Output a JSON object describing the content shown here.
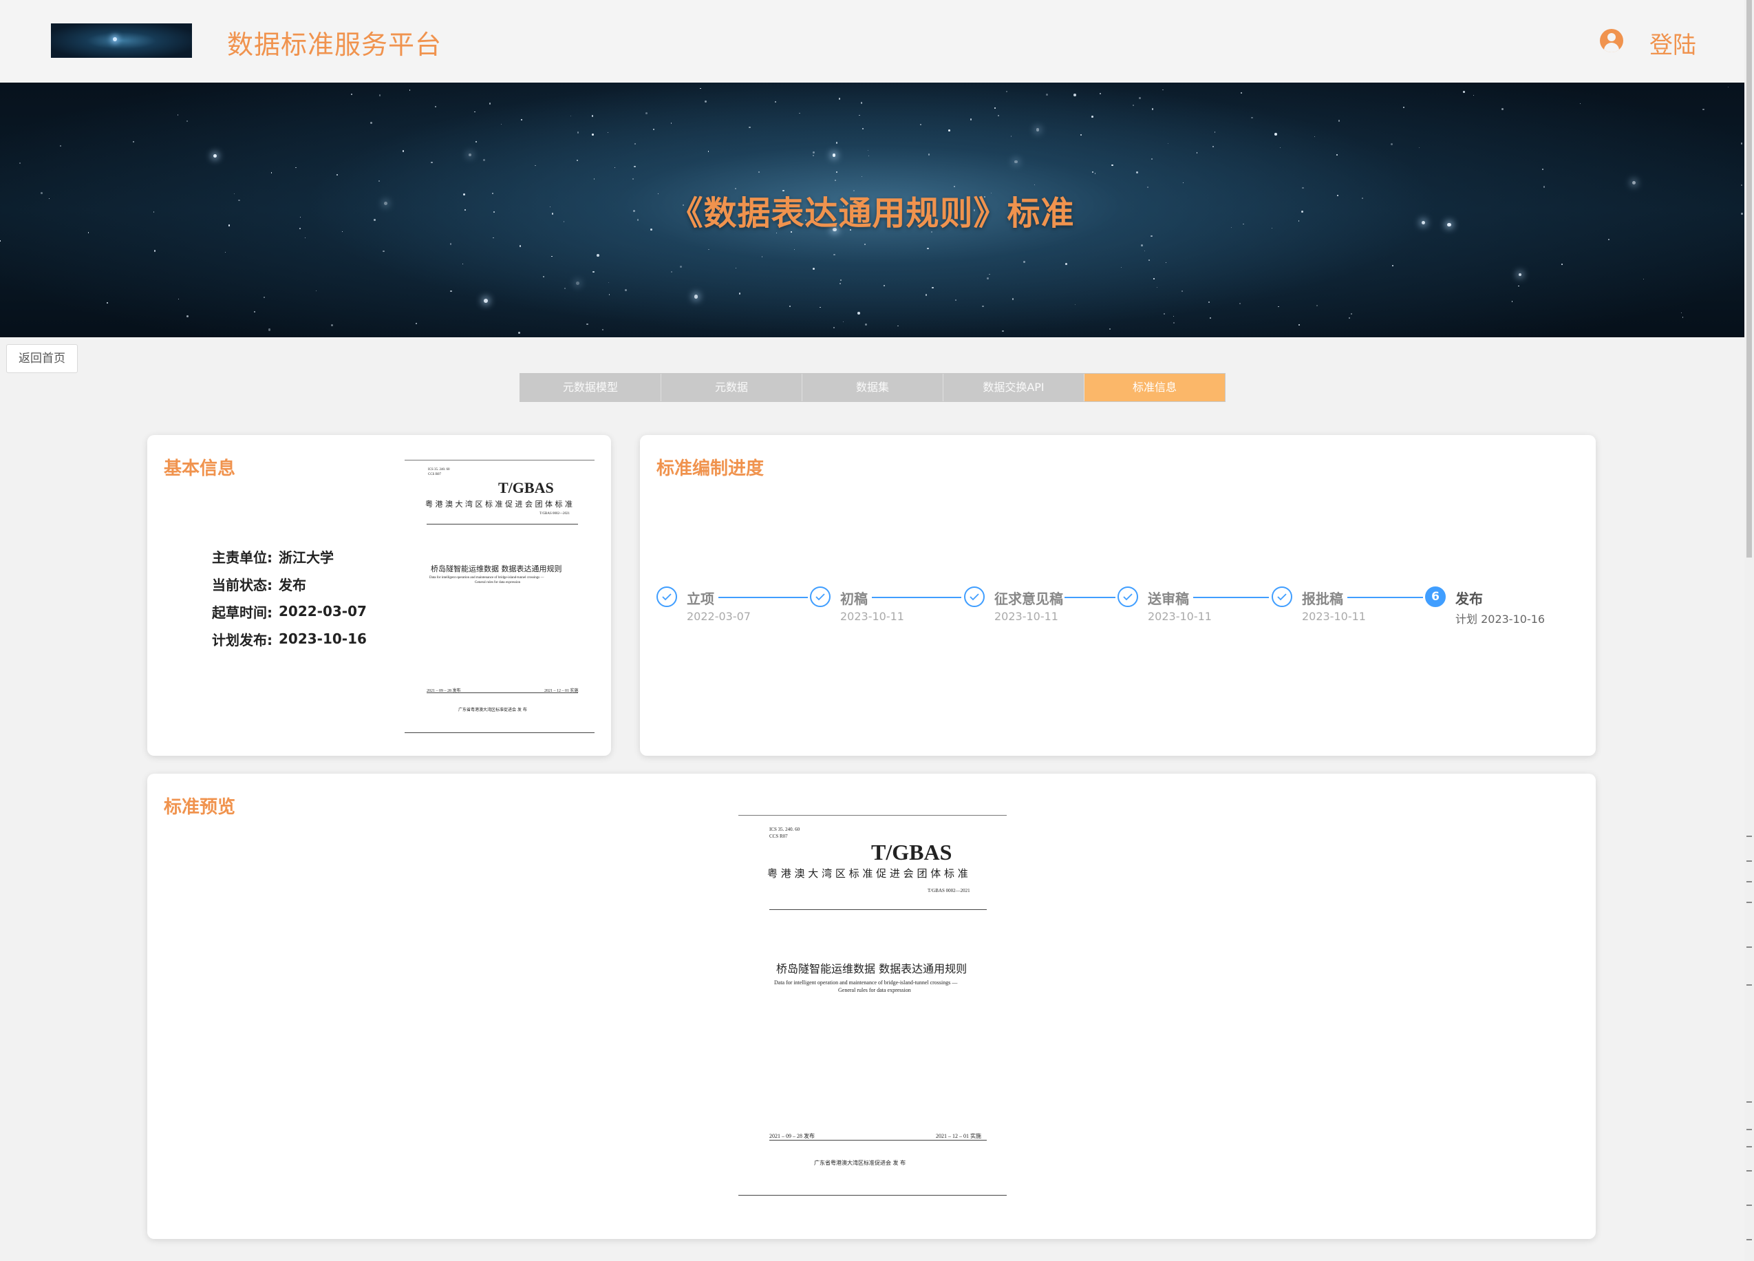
{
  "header": {
    "site_title": "数据标准服务平台",
    "login_label": "登陆",
    "user_icon": "user-circle-icon",
    "accent_color": "#f0934e"
  },
  "banner": {
    "title": "《数据表达通用规则》标准"
  },
  "nav": {
    "back_label": "返回首页",
    "tabs": [
      {
        "label": "元数据模型",
        "active": false
      },
      {
        "label": "元数据",
        "active": false
      },
      {
        "label": "数据集",
        "active": false
      },
      {
        "label": "数据交换API",
        "active": false
      },
      {
        "label": "标准信息",
        "active": true
      }
    ]
  },
  "basic_info": {
    "title": "基本信息",
    "rows": [
      {
        "key": "主责单位:",
        "value": "浙江大学"
      },
      {
        "key": "当前状态:",
        "value": "发布"
      },
      {
        "key": "起草时间:",
        "value": "2022-03-07"
      },
      {
        "key": "计划发布:",
        "value": "2023-10-16"
      }
    ]
  },
  "document": {
    "ics": "ICS  35. 240. 60",
    "ccs": "CCS  R07",
    "code": "T/GBAS",
    "org": "粤 港 澳 大 湾 区 标 准 促 进 会 团 体 标 准",
    "number": "T/GBAS  0002—2021",
    "title_cn": "桥岛隧智能运维数据  数据表达通用规则",
    "title_en_1": "Data for intelligent operation and maintenance of bridge-island-tunnel crossings —",
    "title_en_2": "General rules for data expression",
    "issue_date": "2021 – 09 – 28 发布",
    "impl_date": "2021 – 12 – 01 实施",
    "publisher": "广东省粤港澳大湾区标准促进会     发 布"
  },
  "progress": {
    "title": "标准编制进度",
    "status_color": "#409eff",
    "steps": [
      {
        "label": "立项",
        "date": "2022-03-07",
        "done": true
      },
      {
        "label": "初稿",
        "date": "2023-10-11",
        "done": true
      },
      {
        "label": "征求意见稿",
        "date": "2023-10-11",
        "done": true
      },
      {
        "label": "送审稿",
        "date": "2023-10-11",
        "done": true
      },
      {
        "label": "报批稿",
        "date": "2023-10-11",
        "done": true
      },
      {
        "label": "发布",
        "date": "计划 2023-10-16",
        "done": false,
        "number": "6"
      }
    ]
  },
  "preview": {
    "title": "标准预览"
  }
}
